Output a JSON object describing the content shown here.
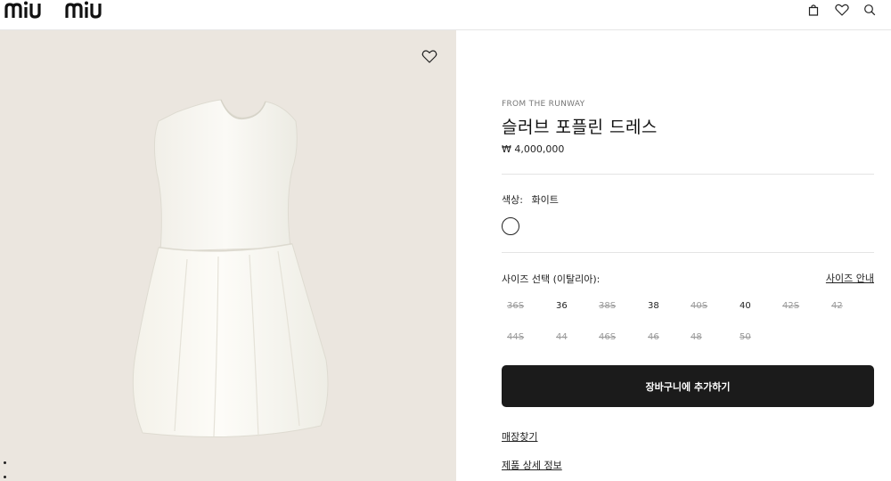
{
  "header": {
    "logo_text": "miu miu",
    "icons": [
      "bag-icon",
      "heart-icon",
      "search-icon"
    ]
  },
  "gallery": {
    "wishlist_icon": "heart-icon",
    "pager_dots": 2
  },
  "product": {
    "eyebrow": "FROM THE RUNWAY",
    "title": "슬러브 포플린 드레스",
    "price": "₩ 4,000,000",
    "color_label": "색상:",
    "color_value": "화이트",
    "size_label": "사이즈 선택 (이탈리아):",
    "size_guide": "사이즈 안내",
    "sizes": [
      {
        "label": "36S",
        "available": false
      },
      {
        "label": "36",
        "available": true
      },
      {
        "label": "38S",
        "available": false
      },
      {
        "label": "38",
        "available": true
      },
      {
        "label": "40S",
        "available": false
      },
      {
        "label": "40",
        "available": true
      },
      {
        "label": "42S",
        "available": false
      },
      {
        "label": "42",
        "available": false
      },
      {
        "label": "44S",
        "available": false
      },
      {
        "label": "44",
        "available": false
      },
      {
        "label": "46S",
        "available": false
      },
      {
        "label": "46",
        "available": false
      },
      {
        "label": "48",
        "available": false
      },
      {
        "label": "50",
        "available": false
      }
    ],
    "add_to_cart": "장바구니에 추가하기",
    "find_store": "매장찾기",
    "details": "제품 상세 정보"
  },
  "colors": {
    "image_bg": "#ebe6df",
    "button_bg": "#1b1b1b"
  }
}
